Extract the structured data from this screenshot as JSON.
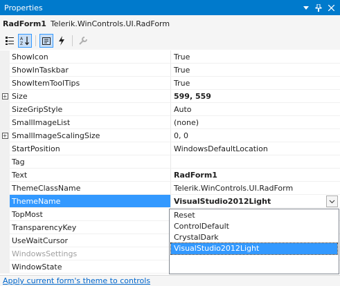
{
  "titlebar": {
    "title": "Properties"
  },
  "object": {
    "name": "RadForm1",
    "type": "Telerik.WinControls.UI.RadForm"
  },
  "toolbar": {
    "buttons": [
      "categorized",
      "alphabetical",
      "properties",
      "events",
      "property-pages"
    ]
  },
  "rows": [
    {
      "name": "ShowIcon",
      "value": "True"
    },
    {
      "name": "ShowInTaskbar",
      "value": "True"
    },
    {
      "name": "ShowItemToolTips",
      "value": "True"
    },
    {
      "name": "Size",
      "value": "599, 559",
      "expandable": true,
      "bold": true
    },
    {
      "name": "SizeGripStyle",
      "value": "Auto"
    },
    {
      "name": "SmallImageList",
      "value": "(none)"
    },
    {
      "name": "SmallImageScalingSize",
      "value": "0, 0",
      "expandable": true
    },
    {
      "name": "StartPosition",
      "value": "WindowsDefaultLocation"
    },
    {
      "name": "Tag",
      "value": ""
    },
    {
      "name": "Text",
      "value": "RadForm1",
      "bold": true
    },
    {
      "name": "ThemeClassName",
      "value": "Telerik.WinControls.UI.RadForm"
    },
    {
      "name": "ThemeName",
      "value": "VisualStudio2012Light",
      "selected": true
    },
    {
      "name": "TopMost",
      "value": ""
    },
    {
      "name": "TransparencyKey",
      "value": ""
    },
    {
      "name": "UseWaitCursor",
      "value": ""
    },
    {
      "name": "WindowsSettings",
      "value": "",
      "dim": true
    },
    {
      "name": "WindowState",
      "value": ""
    }
  ],
  "dropdown": {
    "options": [
      "Reset",
      "ControlDefault",
      "CrystalDark",
      "VisualStudio2012Light"
    ],
    "selected": "VisualStudio2012Light"
  },
  "footer": {
    "link_text": "Apply current form's theme to controls"
  },
  "colors": {
    "accent": "#007acc",
    "selection": "#3399ff",
    "link": "#0066cc"
  }
}
